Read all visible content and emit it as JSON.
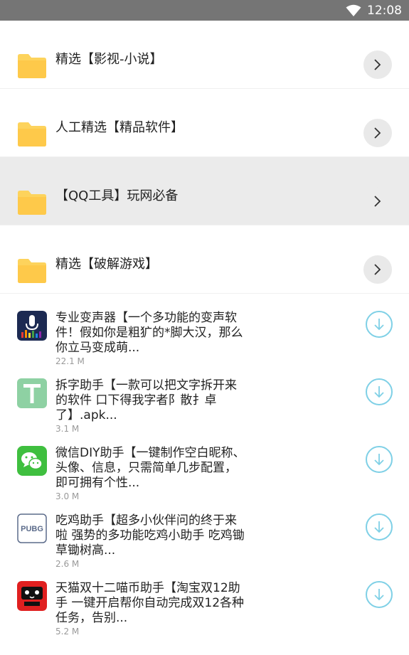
{
  "status_bar": {
    "time": "12:08",
    "wifi_icon": "wifi-icon"
  },
  "folders": [
    {
      "label": "精选【影视-小说】",
      "icon": "folder-icon",
      "highlighted": false
    },
    {
      "label": "人工精选【精品软件】",
      "icon": "folder-icon",
      "highlighted": false
    },
    {
      "label": "【QQ工具】玩网必备",
      "icon": "folder-icon",
      "highlighted": true
    },
    {
      "label": "精选【破解游戏】",
      "icon": "folder-icon",
      "highlighted": false
    }
  ],
  "apps": [
    {
      "title": "专业变声器【一个多功能的变声软\n件！假如你是粗犷的*脚大汉，那么\n你立马变成萌...",
      "size": "22.1 M",
      "icon": "voice-changer-icon"
    },
    {
      "title": "拆字助手【一款可以把文字拆开来\n的软件 口下得我字者阝散扌卓\n了】.apk...",
      "size": "3.1 M",
      "icon": "letter-t-icon"
    },
    {
      "title": "微信DIY助手【一键制作空白昵称、\n头像、信息，只需简单几步配置，\n即可拥有个性...",
      "size": "3.0 M",
      "icon": "wechat-icon"
    },
    {
      "title": "吃鸡助手【超多小伙伴问的终于来\n啦 强势的多功能吃鸡小助手 吃鸡锄\n草锄树高...",
      "size": "2.6 M",
      "icon": "pubg-icon"
    },
    {
      "title": "天猫双十二喵币助手【淘宝双12助\n手 一键开启帮你自动完成双12各种\n任务，告别...",
      "size": "5.2 M",
      "icon": "tmall-icon"
    }
  ],
  "colors": {
    "status_bar": "#757575",
    "folder": "#fdd35c",
    "download_ring": "#7fd0e6",
    "highlight_row": "#ebebeb"
  },
  "pubg_label": "PUBG"
}
